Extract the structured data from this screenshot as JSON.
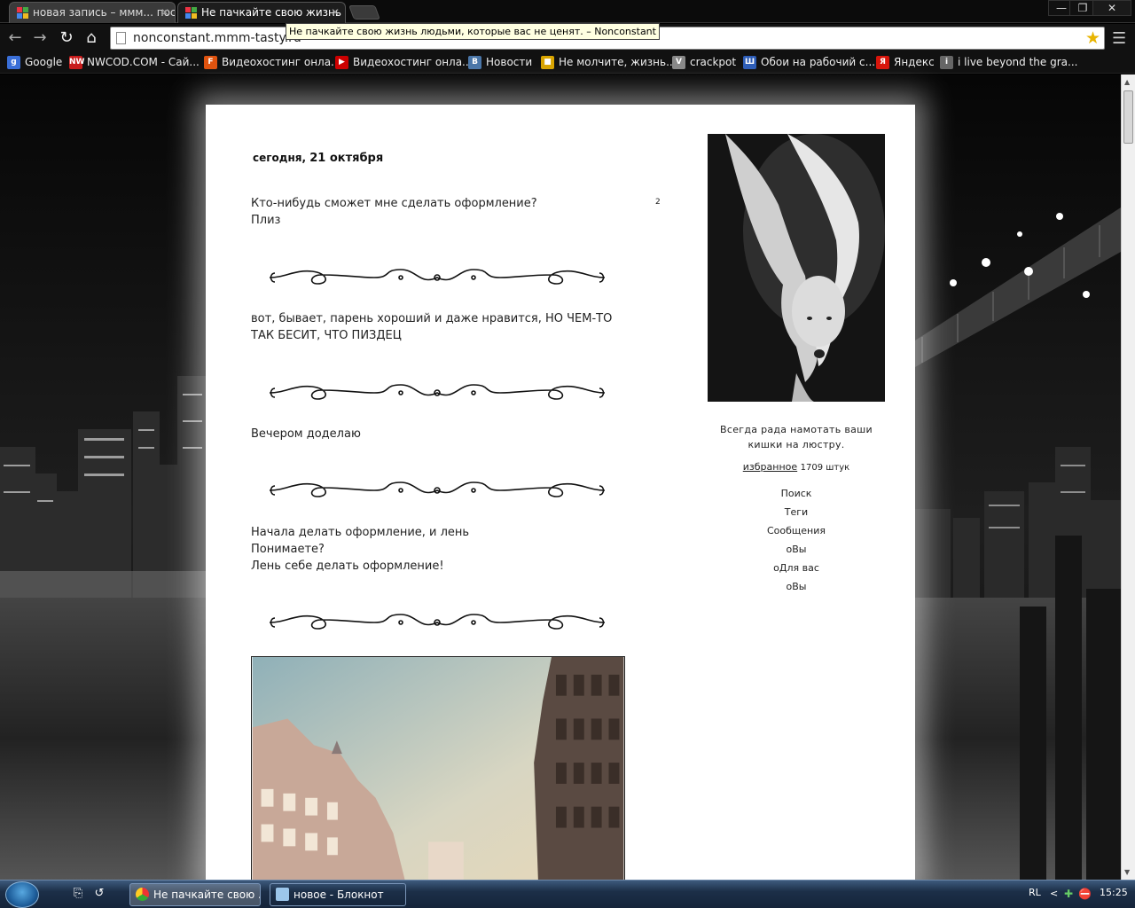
{
  "browser": {
    "tabs": [
      {
        "title": "новая запись – ммм... пос",
        "active": false
      },
      {
        "title": "Не пачкайте свою жизнь",
        "active": true
      }
    ],
    "window_controls": {
      "minimize": "—",
      "restore": "❐",
      "close": "✕"
    },
    "url": "nonconstant.mmm-tasty.ru",
    "tooltip": "Не пачкайте свою жизнь людьми, которые вас не ценят. – Nonconstant",
    "bookmarks": [
      {
        "label": "Google",
        "icon": "google-icon",
        "color": "#3a6fd8",
        "glyph": "g"
      },
      {
        "label": "NWCOD.COM - Сай...",
        "icon": "nwcod-icon",
        "color": "#c81c1c",
        "glyph": "NW"
      },
      {
        "label": "Видеохостинг онла...",
        "icon": "video-f-icon",
        "color": "#e0530f",
        "glyph": "F"
      },
      {
        "label": "Видеохостинг онла...",
        "icon": "youtube-icon",
        "color": "#cc0000",
        "glyph": "▶"
      },
      {
        "label": "Новости",
        "icon": "vk-icon",
        "color": "#4a76a8",
        "glyph": "В"
      },
      {
        "label": "Не молчите, жизнь...",
        "icon": "tasty-icon",
        "color": "#d8a400",
        "glyph": "■"
      },
      {
        "label": "crackpot",
        "icon": "crackpot-icon",
        "color": "#888888",
        "glyph": "V"
      },
      {
        "label": "Обои на рабочий с...",
        "icon": "wallpaper-icon",
        "color": "#2d5db8",
        "glyph": "Ш"
      },
      {
        "label": "Яндекс",
        "icon": "yandex-icon",
        "color": "#d8150b",
        "glyph": "Я"
      },
      {
        "label": "i live beyond the gra...",
        "icon": "blog-icon",
        "color": "#666666",
        "glyph": "i"
      }
    ]
  },
  "blog": {
    "date_prefix": "сегодня,",
    "date_main": "21 октября",
    "comment_count": "2",
    "posts": [
      {
        "lines": [
          "Кто-нибудь сможет мне сделать оформление?",
          "Плиз"
        ]
      },
      {
        "lines": [
          "вот, бывает, парень хороший и даже нравится, НО ЧЕМ-ТО",
          "ТАК БЕСИТ, ЧТО ПИЗДЕЦ"
        ]
      },
      {
        "lines": [
          "Вечером доделаю"
        ]
      },
      {
        "lines": [
          "Начала делать оформление, и лень",
          "Понимаете?",
          "Лень себе делать оформление!"
        ]
      }
    ],
    "sidebar": {
      "motto_line1": "Всегда рада намотать ваши",
      "motto_line2": "кишки на люстру.",
      "favorites_link": "избранное",
      "favorites_count": "1709 штук",
      "menu": [
        "Поиск",
        "Теги",
        "Сообщения",
        "оВы",
        "оДля вас",
        "оВы"
      ]
    }
  },
  "taskbar": {
    "items": [
      {
        "label": "Не пачкайте свою ...",
        "active": true
      },
      {
        "label": "новое - Блокнот",
        "active": false
      }
    ],
    "language": "RL",
    "clock": "15:25"
  }
}
